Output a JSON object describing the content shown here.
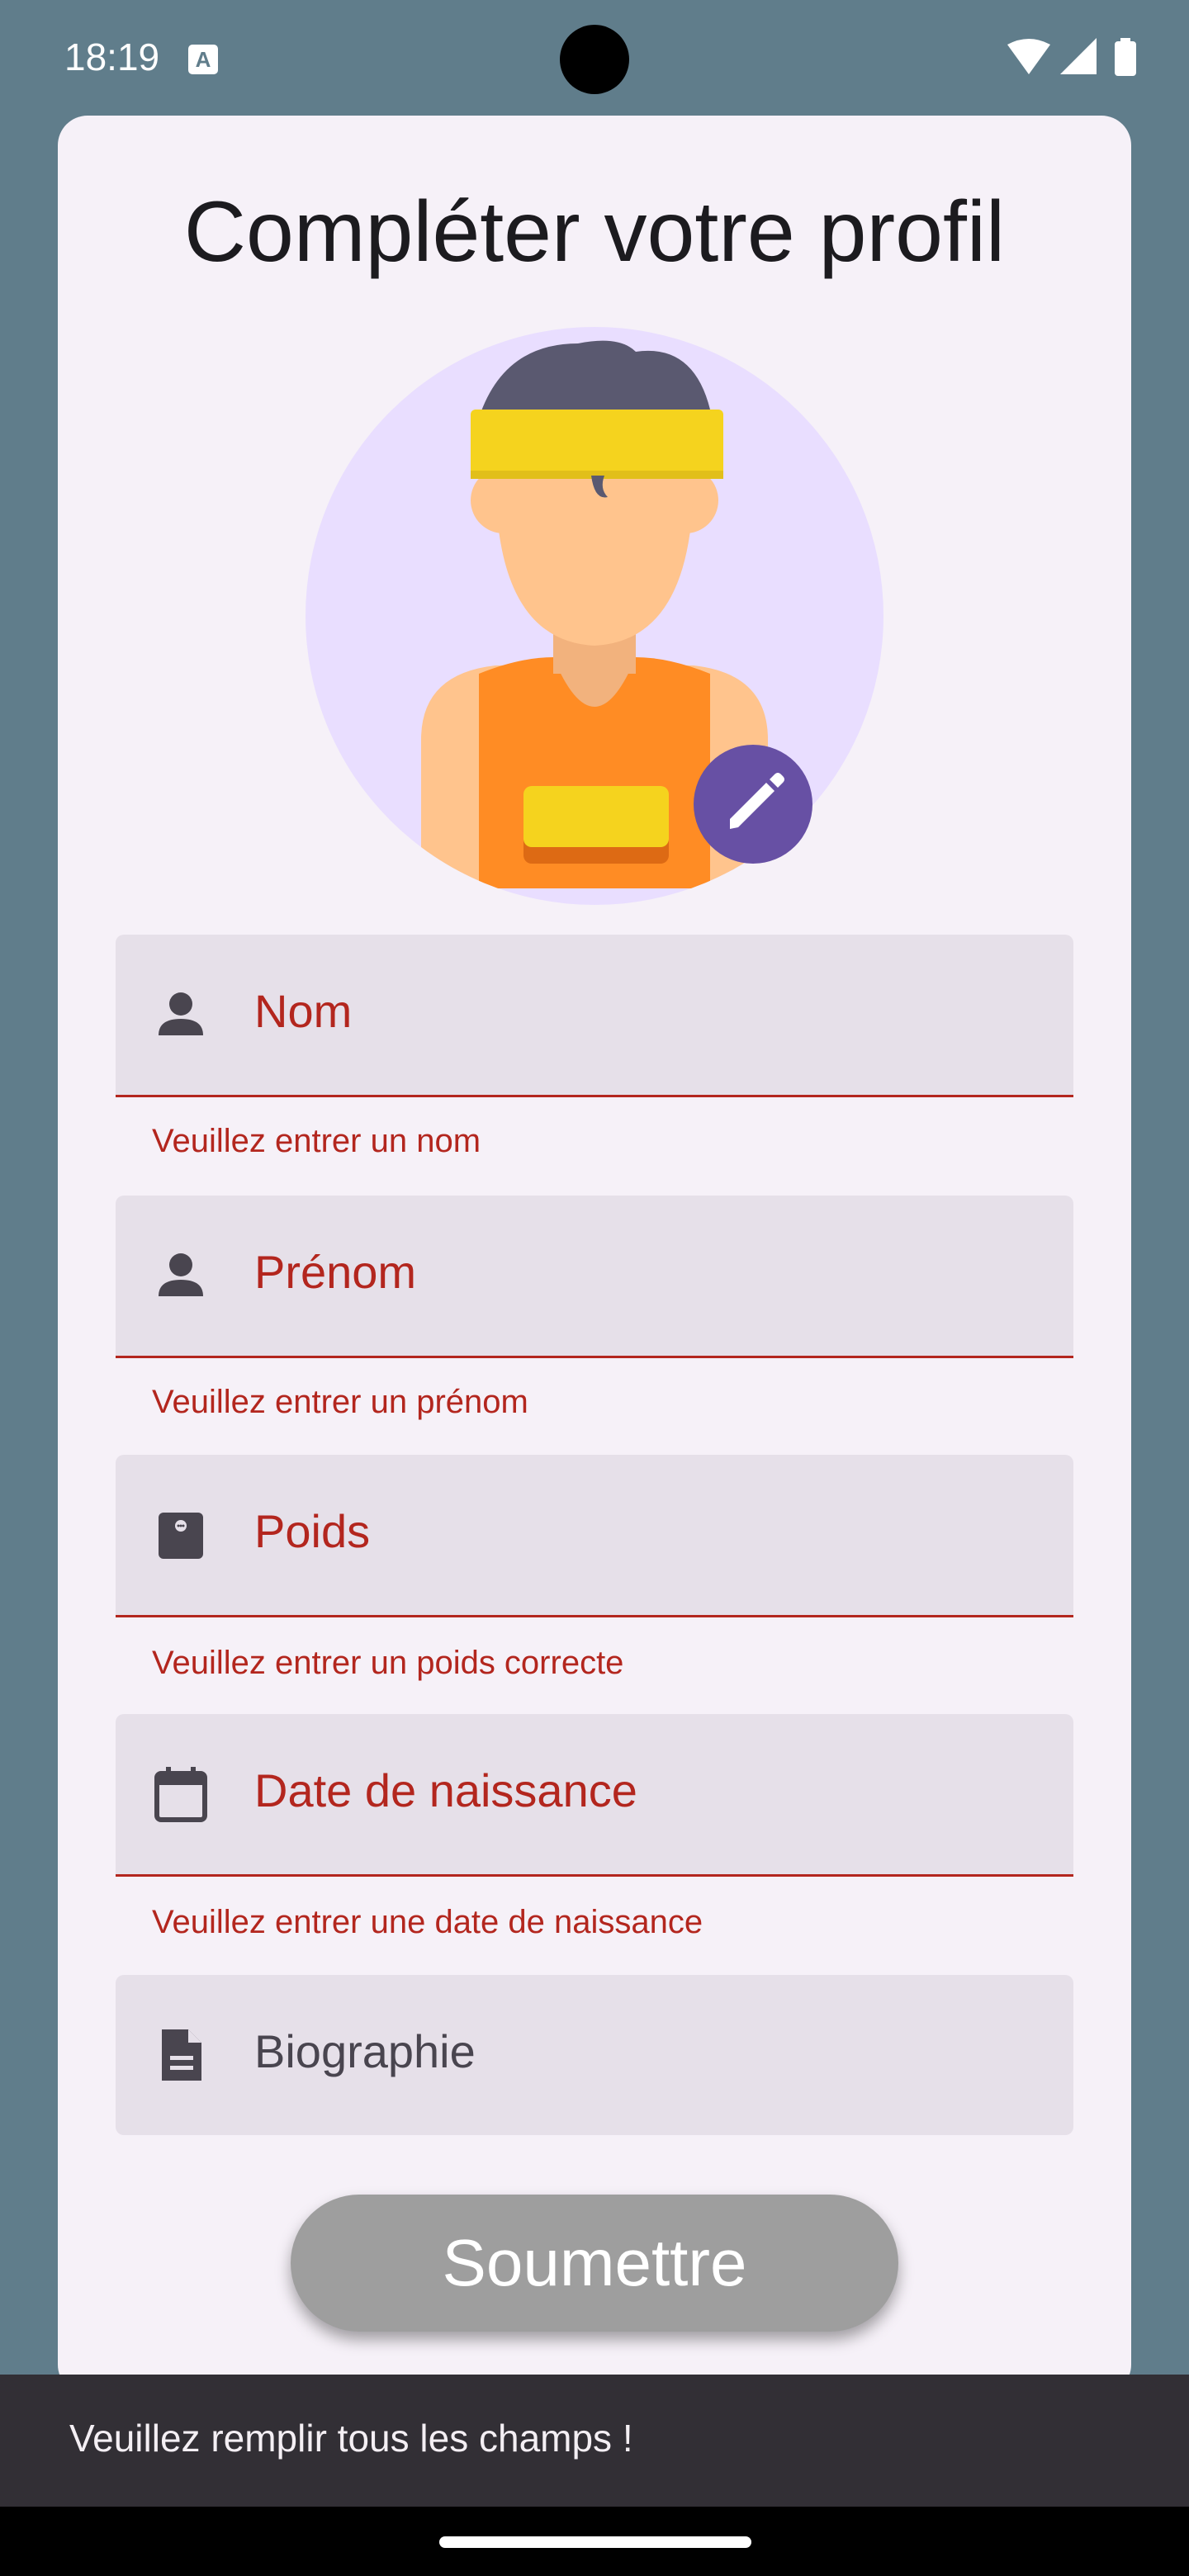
{
  "status_bar": {
    "time": "18:19",
    "notification_letter": "A"
  },
  "page": {
    "title": "Compléter votre profil"
  },
  "fields": [
    {
      "label": "Nom",
      "error": "Veuillez entrer un nom",
      "icon": "person-icon"
    },
    {
      "label": "Prénom",
      "error": "Veuillez entrer un prénom",
      "icon": "person-icon"
    },
    {
      "label": "Poids",
      "error": "Veuillez entrer un poids correcte",
      "icon": "scale-icon"
    },
    {
      "label": "Date de naissance",
      "error": "Veuillez entrer une date de naissance",
      "icon": "calendar-icon"
    },
    {
      "label": "Biographie",
      "icon": "document-icon"
    }
  ],
  "submit": {
    "label": "Soumettre"
  },
  "snackbar": {
    "message": "Veuillez remplir tous les champs !"
  },
  "colors": {
    "error": "#b3261e",
    "accent": "#6750a4",
    "background": "#607d8b",
    "card": "#f6f1f8"
  }
}
